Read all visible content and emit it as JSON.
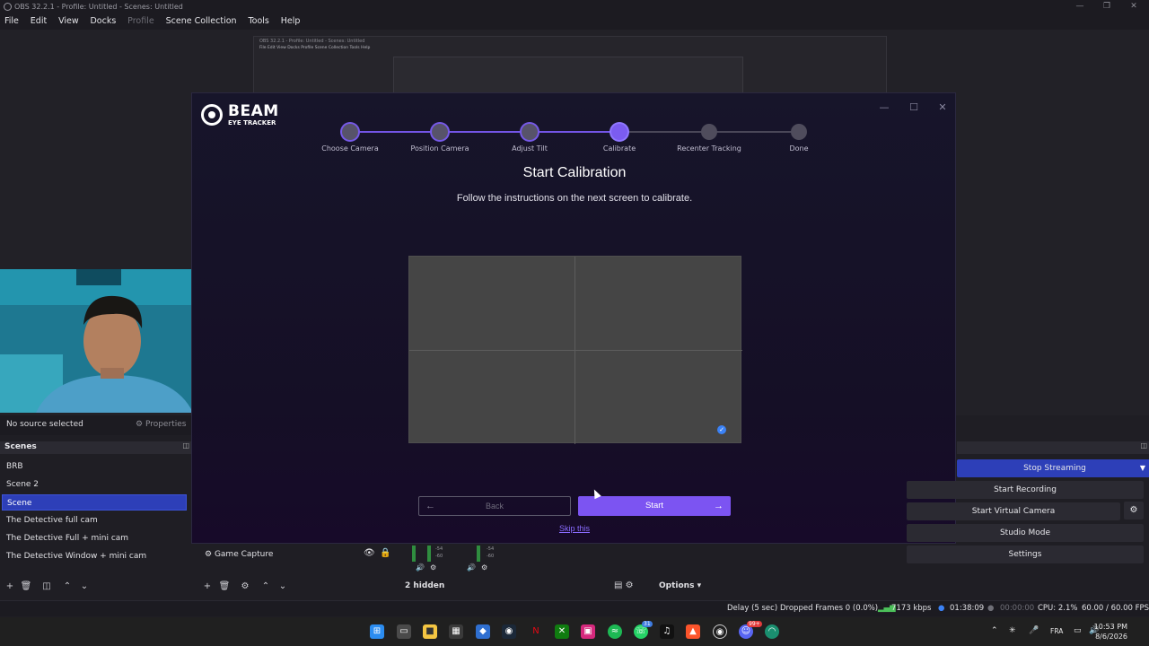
{
  "obs": {
    "window_title": "OBS 32.2.1 - Profile: Untitled - Scenes: Untitled",
    "menu": [
      "File",
      "Edit",
      "View",
      "Docks",
      "Profile",
      "Scene Collection",
      "Tools",
      "Help"
    ],
    "nested": {
      "title": "OBS 32.2.1 - Profile: Untitled - Scenes: Untitled",
      "menu": "File  Edit  View  Docks  Profile  Scene Collection  Tools  Help"
    }
  },
  "beam": {
    "logo_title": "BEAM",
    "logo_sub": "EYE TRACKER",
    "steps": [
      {
        "label": "Choose Camera",
        "state": "done"
      },
      {
        "label": "Position Camera",
        "state": "done"
      },
      {
        "label": "Adjust Tilt",
        "state": "done"
      },
      {
        "label": "Calibrate",
        "state": "active"
      },
      {
        "label": "Recenter Tracking",
        "state": "pending"
      },
      {
        "label": "Done",
        "state": "pending"
      }
    ],
    "heading": "Start Calibration",
    "subtext": "Follow the instructions on the next screen to calibrate.",
    "back_label": "Back",
    "start_label": "Start",
    "skip_label": "Skip this",
    "accent_color": "#7c54f2"
  },
  "source_bar": {
    "no_source": "No source selected",
    "properties": "Properties"
  },
  "scenes": {
    "header": "Scenes",
    "items": [
      "BRB",
      "Scene 2",
      "Scene",
      "The Detective full cam",
      "The Detective Full + mini cam",
      "The Detective Window + mini cam"
    ],
    "selected_index": 2
  },
  "sources": {
    "items": [
      {
        "name": "Game Capture"
      }
    ]
  },
  "mixer": {
    "hidden_label": "2 hidden",
    "options_label": "Options",
    "meter_labels": [
      "-54",
      "-60",
      "-54",
      "-60"
    ]
  },
  "controls": {
    "buttons": [
      "Stop Streaming",
      "Start Recording",
      "Start Virtual Camera",
      "Studio Mode",
      "Settings"
    ],
    "stream_color": "#2d3fb8"
  },
  "status": {
    "delay": "Delay (5 sec)",
    "dropped": "Dropped Frames 0 (0.0%)",
    "bitrate": "7173 kbps",
    "stream_time": "01:38:09",
    "rec_time": "00:00:00",
    "cpu": "CPU: 2.1%",
    "fps": "60.00 / 60.00 FPS"
  },
  "taskbar": {
    "lang": "FRA",
    "time": "10:53 PM",
    "date": "8/6/2026",
    "badge_whatsapp": "31",
    "badge_discord": "99+"
  }
}
